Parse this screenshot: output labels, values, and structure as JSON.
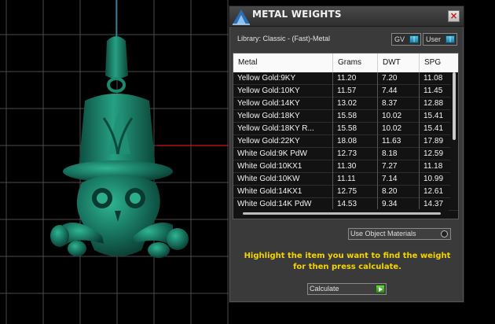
{
  "dialog": {
    "title": "METAL WEIGHTS",
    "close_label": "×",
    "app_icon": "app-logo-icon"
  },
  "library": {
    "label": "Library: Classic - (Fast)-Metal",
    "toggles": [
      {
        "label": "GV",
        "state": "on"
      },
      {
        "label": "User",
        "state": "on"
      }
    ]
  },
  "table": {
    "columns": [
      "Metal",
      "Grams",
      "DWT",
      "SPG"
    ],
    "rows": [
      [
        "Yellow Gold:9KY",
        "11.20",
        "7.20",
        "11.08"
      ],
      [
        "Yellow Gold:10KY",
        "11.57",
        "7.44",
        "11.45"
      ],
      [
        "Yellow Gold:14KY",
        "13.02",
        "8.37",
        "12.88"
      ],
      [
        "Yellow Gold:18KY",
        "15.58",
        "10.02",
        "15.41"
      ],
      [
        "Yellow Gold:18KY R...",
        "15.58",
        "10.02",
        "15.41"
      ],
      [
        "Yellow Gold:22KY",
        "18.08",
        "11.63",
        "17.89"
      ],
      [
        "White Gold:9K PdW",
        "12.73",
        "8.18",
        "12.59"
      ],
      [
        "White Gold:10KX1",
        "11.30",
        "7.27",
        "11.18"
      ],
      [
        "White Gold:10KW",
        "11.11",
        "7.14",
        "10.99"
      ],
      [
        "White Gold:14KX1",
        "12.75",
        "8.20",
        "12.61"
      ],
      [
        "White Gold:14K PdW",
        "14.53",
        "9.34",
        "14.37"
      ]
    ]
  },
  "options": {
    "use_object_materials": "Use Object Materials"
  },
  "instructions": {
    "line1": "Highlight the item you want to find the weight",
    "line2": "for then press calculate."
  },
  "calculate": {
    "label": "Calculate"
  },
  "colors": {
    "model": "#17725e",
    "panel": "#3a3a3a",
    "instruction_text": "#f5d500",
    "grid": "#4a4a4a",
    "axis_x": "#d11414",
    "axis_y": "#1fa0c8"
  }
}
